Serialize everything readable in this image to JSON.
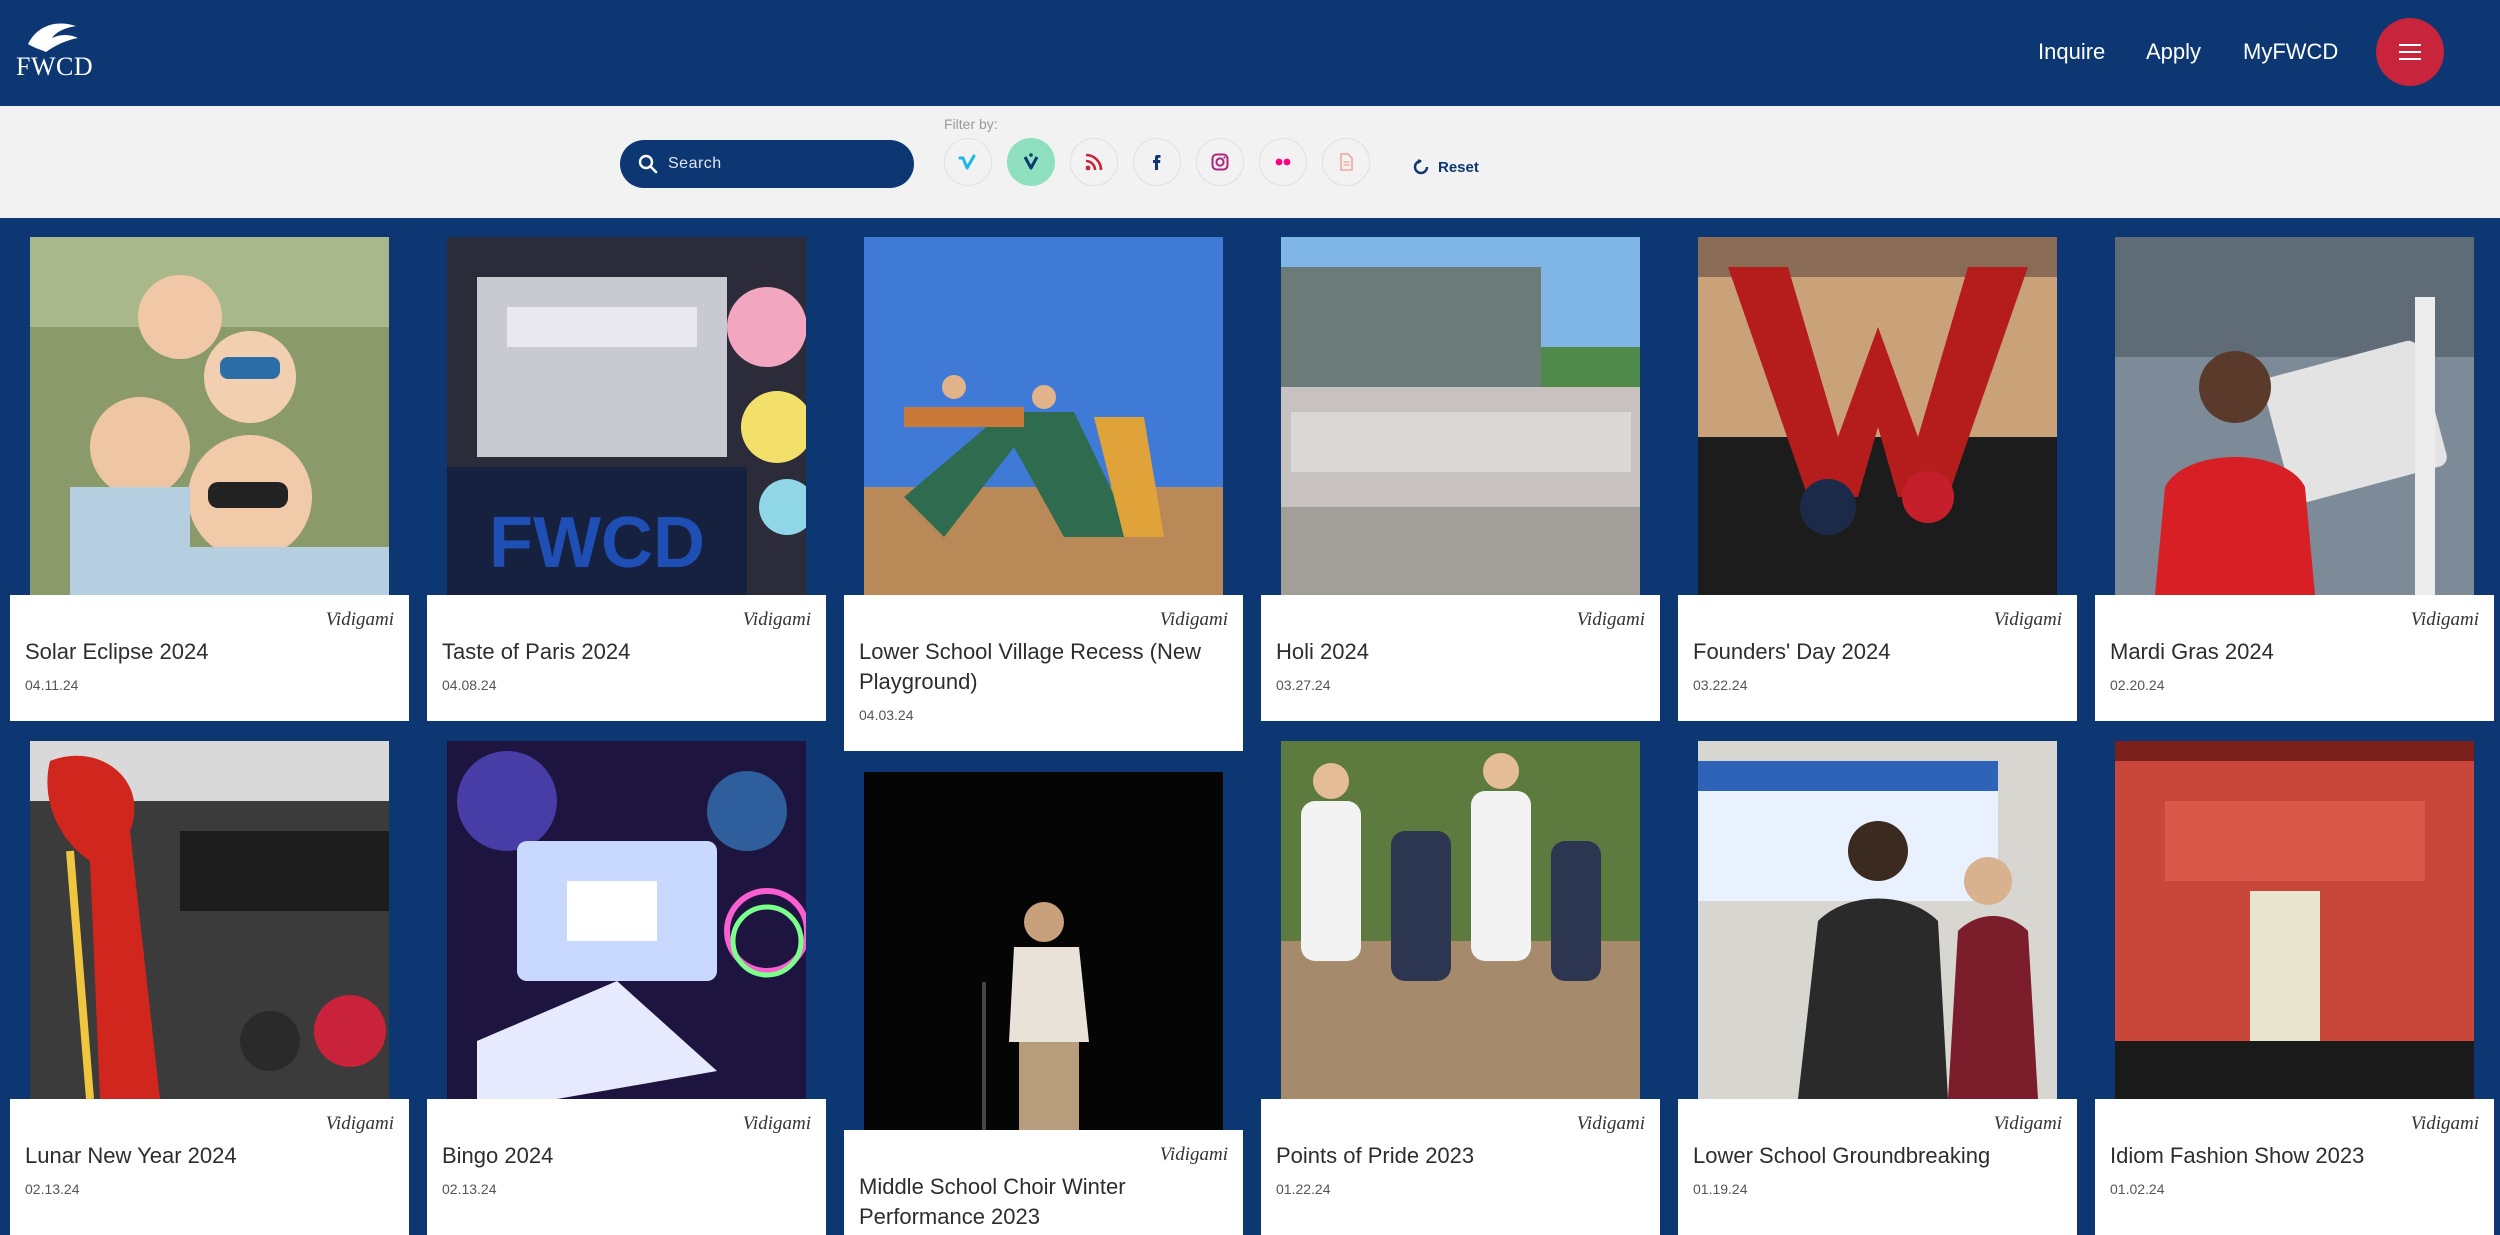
{
  "header": {
    "logo_text": "FWCD",
    "nav": [
      "Inquire",
      "Apply",
      "MyFWCD"
    ],
    "menu_icon": "hamburger-icon",
    "menu_color": "#c8243b",
    "brand_color": "#0c3772"
  },
  "filterbar": {
    "search_placeholder": "Search",
    "filter_label": "Filter by:",
    "filters": [
      {
        "name": "vimeo",
        "icon": "vimeo-icon",
        "glyph": "v",
        "color": "#1ab7ea",
        "active": false
      },
      {
        "name": "vidigami",
        "icon": "vidigami-icon",
        "glyph": "v",
        "color": "#0c3772",
        "active": true
      },
      {
        "name": "rss",
        "icon": "rss-icon",
        "color": "#c8243b",
        "active": false
      },
      {
        "name": "facebook",
        "icon": "facebook-icon",
        "glyph": "f",
        "color": "#0c3772",
        "active": false
      },
      {
        "name": "instagram",
        "icon": "instagram-icon",
        "color": "#b0237e",
        "active": false
      },
      {
        "name": "flickr",
        "icon": "flickr-icon",
        "color": "#ff0084",
        "active": false
      },
      {
        "name": "document",
        "icon": "document-icon",
        "color": "#f4a79a",
        "active": false
      }
    ],
    "reset_label": "Reset"
  },
  "cards": [
    {
      "source": "Vidigami",
      "title": "Solar Eclipse 2024",
      "date": "04.11.24",
      "palette": [
        "#8b9a6a",
        "#b5cfe0",
        "#f0c8a8"
      ]
    },
    {
      "source": "Vidigami",
      "title": "Taste of Paris 2024",
      "date": "04.08.24",
      "palette": [
        "#2b2b3a",
        "#c9c9d2",
        "#1f4fb5"
      ]
    },
    {
      "source": "Vidigami",
      "title": "Lower School Village Recess (New Playground)",
      "date": "04.03.24",
      "palette": [
        "#3f7ad6",
        "#b98a58",
        "#2f6b4f"
      ]
    },
    {
      "source": "Vidigami",
      "title": "Holi 2024",
      "date": "03.27.24",
      "palette": [
        "#7fb6e6",
        "#6c7a78",
        "#c7c2c0"
      ]
    },
    {
      "source": "Vidigami",
      "title": "Founders' Day 2024",
      "date": "03.22.24",
      "palette": [
        "#caa27a",
        "#1c1c1c",
        "#b51d1d"
      ]
    },
    {
      "source": "Vidigami",
      "title": "Mardi Gras 2024",
      "date": "02.20.24",
      "palette": [
        "#7d8a98",
        "#e3e3e3",
        "#d81f26"
      ]
    },
    {
      "source": "Vidigami",
      "title": "Lunar New Year 2024",
      "date": "02.13.24",
      "palette": [
        "#3b3b3b",
        "#d9d9d9",
        "#d1261d"
      ]
    },
    {
      "source": "Vidigami",
      "title": "Bingo 2024",
      "date": "02.13.24",
      "palette": [
        "#1d1440",
        "#5b4fd1",
        "#c9d8ff"
      ]
    },
    {
      "source": "Vidigami",
      "title": "Middle School Choir Winter Performance 2023",
      "date": "",
      "palette": [
        "#050505",
        "#0b0b0b",
        "#e8e2d8"
      ]
    },
    {
      "source": "Vidigami",
      "title": "Points of Pride 2023",
      "date": "01.22.24",
      "palette": [
        "#5d7a3f",
        "#a58a6c",
        "#f3f3f3"
      ]
    },
    {
      "source": "Vidigami",
      "title": "Lower School Groundbreaking",
      "date": "01.19.24",
      "palette": [
        "#d8d6d0",
        "#2a2a2a",
        "#7b1d2a"
      ]
    },
    {
      "source": "Vidigami",
      "title": "Idiom Fashion Show 2023",
      "date": "01.02.24",
      "palette": [
        "#7a1f1a",
        "#c9463a",
        "#e9e6d0"
      ]
    }
  ]
}
